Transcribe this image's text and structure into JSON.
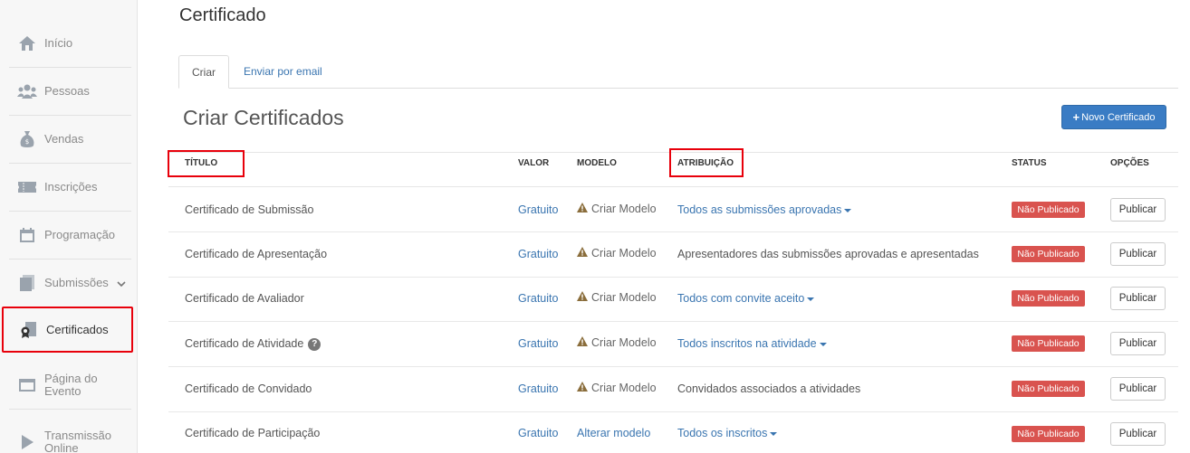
{
  "sidebar": {
    "items": [
      {
        "label": "Início",
        "icon": "home-icon"
      },
      {
        "label": "Pessoas",
        "icon": "users-icon"
      },
      {
        "label": "Vendas",
        "icon": "money-bag-icon"
      },
      {
        "label": "Inscrições",
        "icon": "ticket-icon"
      },
      {
        "label": "Programação",
        "icon": "calendar-icon"
      },
      {
        "label": "Submissões",
        "icon": "document-icon"
      },
      {
        "label": "Certificados",
        "icon": "certificate-icon"
      },
      {
        "label_line1": "Página do",
        "label_line2": "Evento",
        "icon": "browser-icon"
      },
      {
        "label_line1": "Transmissão",
        "label_line2": "Online",
        "icon": "play-icon"
      }
    ]
  },
  "page": {
    "title": "Certificado"
  },
  "tabs": {
    "create": "Criar",
    "email": "Enviar por email"
  },
  "section": {
    "title": "Criar Certificados",
    "new_button": "Novo Certificado"
  },
  "table": {
    "headers": {
      "titulo": "TÍTULO",
      "valor": "VALOR",
      "modelo": "MODELO",
      "atribuicao": "ATRIBUIÇÃO",
      "status": "STATUS",
      "opcoes": "OPÇÕES"
    },
    "rows": [
      {
        "title": "Certificado de Submissão",
        "valor": "Gratuito",
        "modelo": "Criar Modelo",
        "attr": "Todos as submissões aprovadas",
        "status": "Não Publicado",
        "action": "Publicar"
      },
      {
        "title": "Certificado de Apresentação",
        "valor": "Gratuito",
        "modelo": "Criar Modelo",
        "attr": "Apresentadores das submissões aprovadas e apresentadas",
        "status": "Não Publicado",
        "action": "Publicar"
      },
      {
        "title": "Certificado de Avaliador",
        "valor": "Gratuito",
        "modelo": "Criar Modelo",
        "attr": "Todos com convite aceito",
        "status": "Não Publicado",
        "action": "Publicar"
      },
      {
        "title": "Certificado de Atividade",
        "valor": "Gratuito",
        "modelo": "Criar Modelo",
        "attr": "Todos inscritos na atividade",
        "status": "Não Publicado",
        "action": "Publicar"
      },
      {
        "title": "Certificado de Convidado",
        "valor": "Gratuito",
        "modelo": "Criar Modelo",
        "attr": "Convidados associados a atividades",
        "status": "Não Publicado",
        "action": "Publicar"
      },
      {
        "title": "Certificado de Participação",
        "valor": "Gratuito",
        "modelo": "Alterar modelo",
        "attr": "Todos os inscritos",
        "status": "Não Publicado",
        "action": "Publicar"
      }
    ]
  },
  "colors": {
    "accent": "#3a7cc4",
    "link": "#3a75b0",
    "danger": "#d9534f",
    "highlight": "#e8000b"
  }
}
